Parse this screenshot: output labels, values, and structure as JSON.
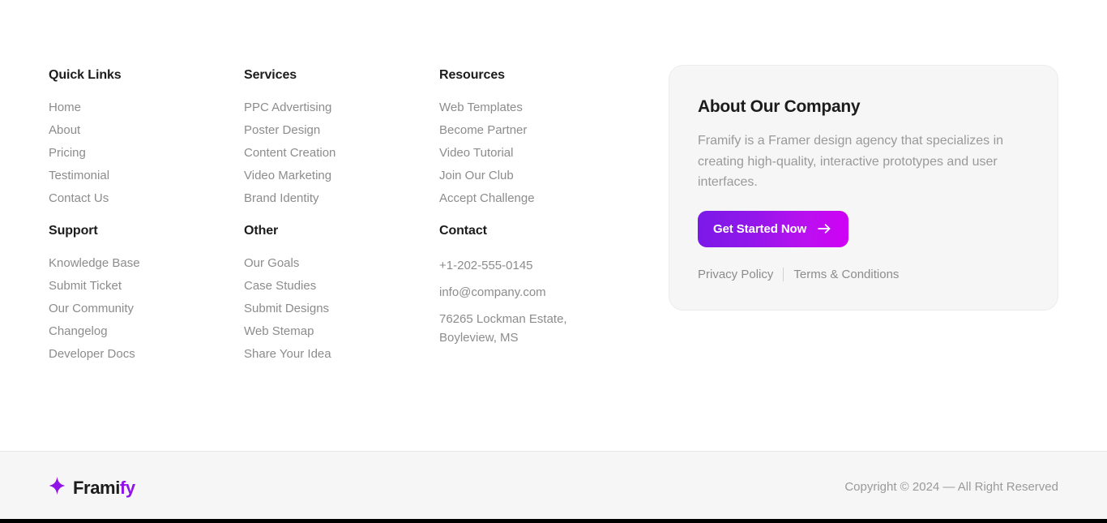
{
  "footer": {
    "columns_row1": [
      {
        "title": "Quick Links",
        "name": "quick-links",
        "links": [
          "Home",
          "About",
          "Pricing",
          "Testimonial",
          "Contact Us"
        ]
      },
      {
        "title": "Services",
        "name": "services",
        "links": [
          "PPC Advertising",
          "Poster Design",
          "Content Creation",
          "Video Marketing",
          "Brand Identity"
        ]
      },
      {
        "title": "Resources",
        "name": "resources",
        "links": [
          "Web Templates",
          "Become Partner",
          "Video Tutorial",
          "Join Our Club",
          "Accept Challenge"
        ]
      }
    ],
    "columns_row2": [
      {
        "title": "Support",
        "name": "support",
        "links": [
          "Knowledge Base",
          "Submit Ticket",
          "Our Community",
          "Changelog",
          "Developer Docs"
        ]
      },
      {
        "title": "Other",
        "name": "other",
        "links": [
          "Our Goals",
          "Case Studies",
          "Submit Designs",
          "Web Stemap",
          "Share Your Idea"
        ]
      }
    ],
    "contact": {
      "title": "Contact",
      "phone": "+1-202-555-0145",
      "email": "info@company.com",
      "address": "76265 Lockman Estate, Boyleview, MS"
    }
  },
  "about_card": {
    "title": "About Our Company",
    "description": "Framify is a Framer design agency that specializes in creating high-quality, interactive prototypes and user interfaces.",
    "cta_label": "Get Started Now",
    "cta_icon": "arrow-right-icon",
    "privacy_label": "Privacy Policy",
    "terms_label": "Terms & Conditions"
  },
  "bottom_bar": {
    "brand_icon": "sparkle-star-icon",
    "brand_name_primary": "Frami",
    "brand_name_accent": "fy",
    "copyright": "Copyright © 2024 — All Right Reserved"
  },
  "colors": {
    "accent_purple": "#9013e8",
    "cta_gradient_start": "#7a19e8",
    "cta_gradient_end": "#d000f5",
    "heading": "#1c1c1c",
    "muted_text": "#8c8c8c",
    "card_bg": "#f6f6f6",
    "page_bg": "#ffffff"
  }
}
